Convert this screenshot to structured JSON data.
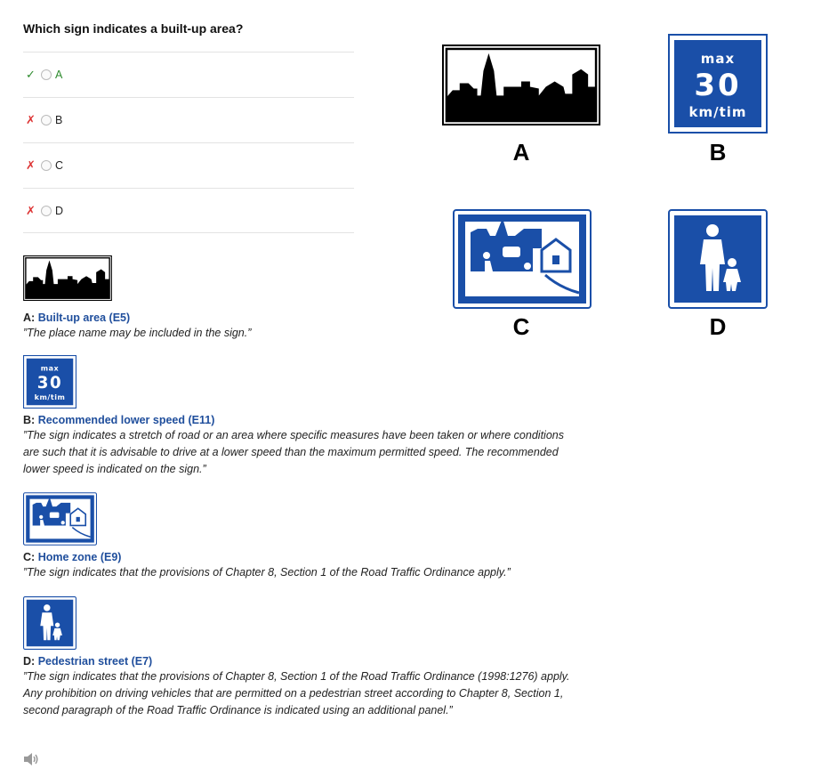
{
  "question": "Which sign indicates a built-up area?",
  "options": [
    {
      "mark": "✓",
      "label": "A"
    },
    {
      "mark": "✗",
      "label": "B"
    },
    {
      "mark": "✗",
      "label": "C"
    },
    {
      "mark": "✗",
      "label": "D"
    }
  ],
  "sign_text": {
    "max": "max",
    "speed": "30",
    "unit": "km/tim"
  },
  "explanations": [
    {
      "letter": "A:",
      "name": "Built-up area (E5)",
      "desc": "”The place name may be included in the sign.”"
    },
    {
      "letter": "B:",
      "name": "Recommended lower speed (E11)",
      "desc": "”The sign indicates a stretch of road or an area where specific measures have been taken or where conditions are such that it is advisable to drive at a lower speed than the maximum permitted speed. The recommended lower speed is indicated on the sign.”"
    },
    {
      "letter": "C:",
      "name": "Home zone (E9)",
      "desc": "”The sign indicates that the provisions of Chapter 8, Section 1 of the Road Traffic Ordinance apply.”"
    },
    {
      "letter": "D:",
      "name": "Pedestrian street (E7)",
      "desc": "”The sign indicates that the provisions of Chapter 8, Section 1 of the Road Traffic Ordinance (1998:1276) apply. Any prohibition on driving vehicles that are permitted on a pedestrian street according to Chapter 8, Section 1, second paragraph of the Road Traffic Ordinance is indicated using an additional panel.”"
    }
  ],
  "big_labels": [
    "A",
    "B",
    "C",
    "D"
  ],
  "colors": {
    "sign_blue": "#1a4fa8",
    "link_blue": "#1f4e9c",
    "correct_green": "#2e8b2e",
    "wrong_red": "#dd3333"
  }
}
